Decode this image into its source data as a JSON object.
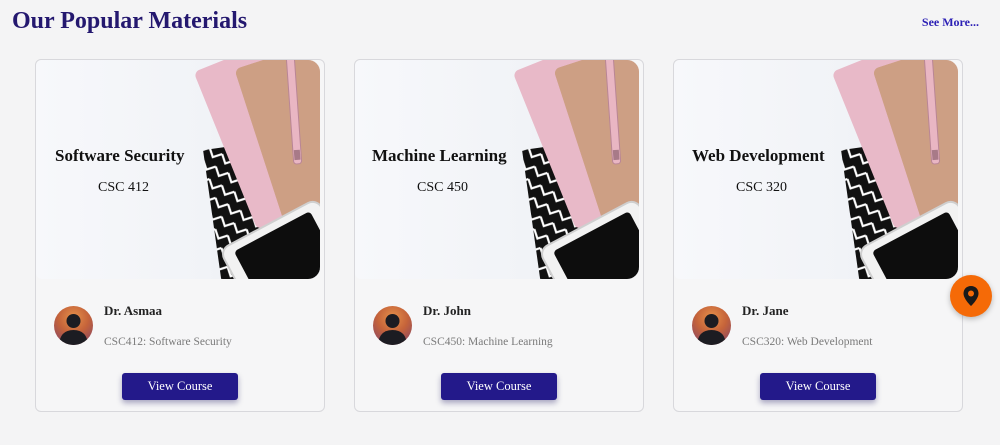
{
  "section": {
    "title": "Our Popular Materials",
    "see_more": "See More..."
  },
  "courses": [
    {
      "title": "Software Security",
      "code": "CSC 412",
      "instructor": "Dr. Asmaa",
      "description": "CSC412: Software Security",
      "button": "View Course"
    },
    {
      "title": "Machine Learning",
      "code": "CSC 450",
      "instructor": "Dr. John",
      "description": "CSC450: Machine Learning",
      "button": "View Course"
    },
    {
      "title": "Web Development",
      "code": "CSC 320",
      "instructor": "Dr. Jane",
      "description": "CSC320: Web Development",
      "button": "View Course"
    }
  ],
  "icons": {
    "floating_button": "map-pin-icon",
    "avatar": "user-silhouette-icon"
  },
  "colors": {
    "title": "#24186f",
    "accent_button": "#23198a",
    "fab": "#f56a07"
  }
}
